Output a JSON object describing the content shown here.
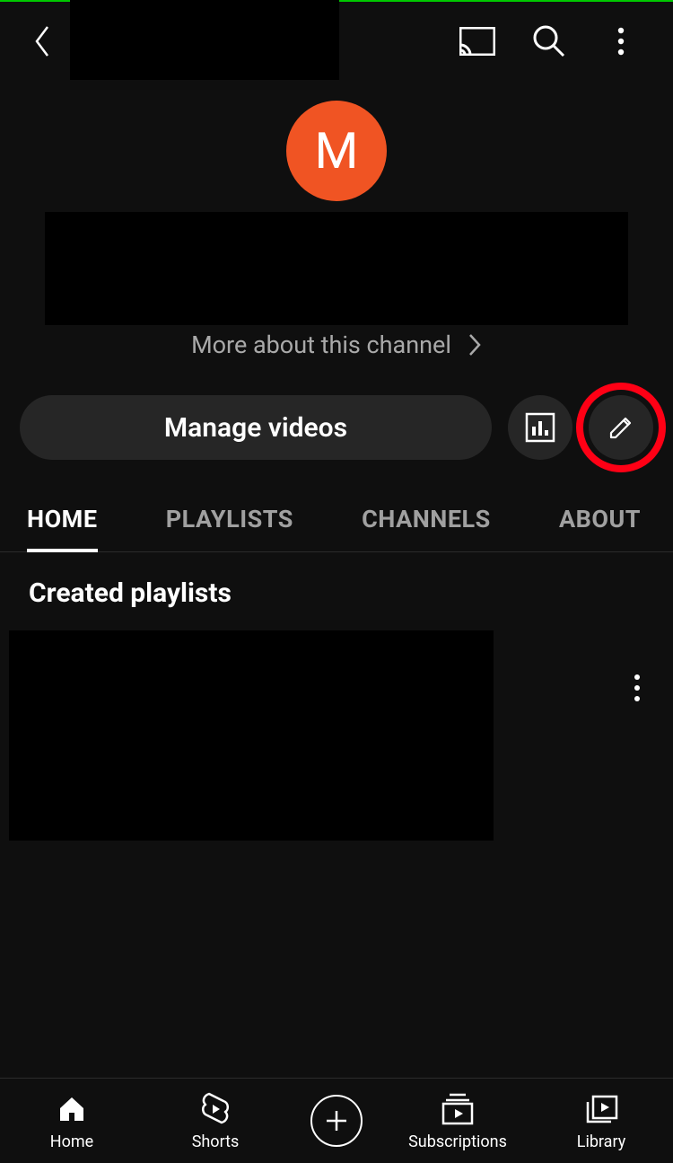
{
  "avatar_letter": "M",
  "more_about_label": "More about this channel",
  "manage_videos_label": "Manage videos",
  "tabs": {
    "home": "HOME",
    "playlists": "PLAYLISTS",
    "channels": "CHANNELS",
    "about": "ABOUT"
  },
  "section_title": "Created playlists",
  "bottom_nav": {
    "home": "Home",
    "shorts": "Shorts",
    "subscriptions": "Subscriptions",
    "library": "Library"
  }
}
